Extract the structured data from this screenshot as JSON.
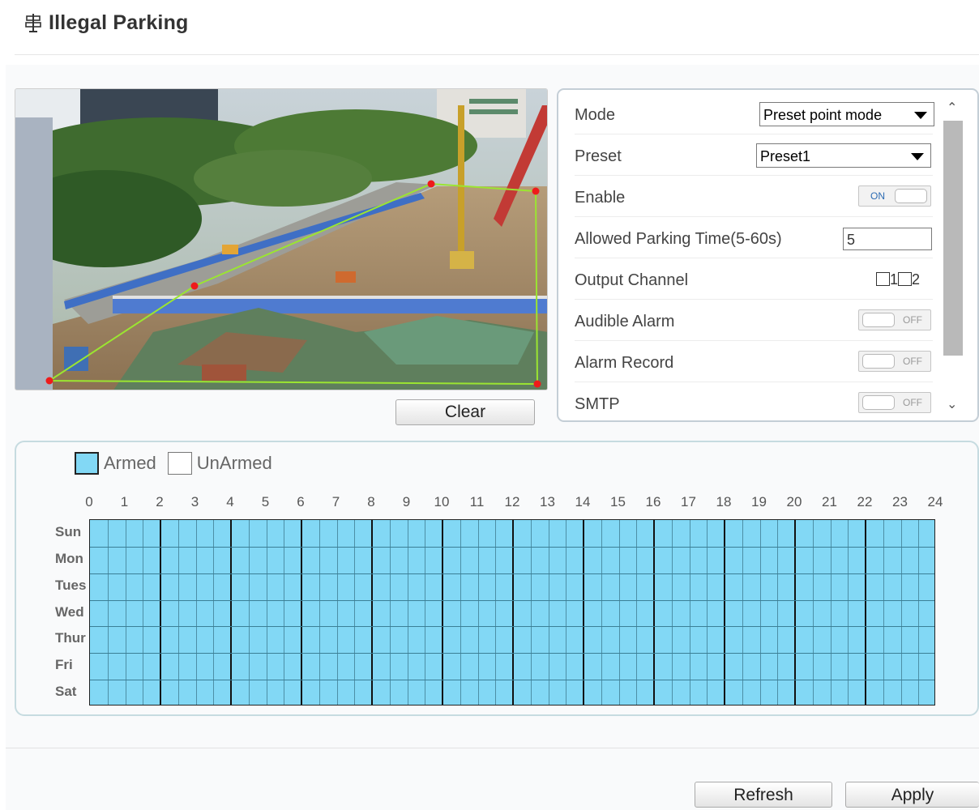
{
  "header": {
    "title": "Illegal Parking"
  },
  "video": {
    "polygon_points_label": "detection-area"
  },
  "clear_label": "Clear",
  "settings": {
    "mode": {
      "label": "Mode",
      "value": "Preset point mode"
    },
    "preset": {
      "label": "Preset",
      "value": "Preset1"
    },
    "enable": {
      "label": "Enable",
      "state": "ON"
    },
    "allowed_time": {
      "label": "Allowed Parking Time(5-60s)",
      "value": "5"
    },
    "output_channel": {
      "label": "Output Channel",
      "ch1": "1",
      "ch2": "2"
    },
    "audible_alarm": {
      "label": "Audible Alarm",
      "state": "OFF"
    },
    "alarm_record": {
      "label": "Alarm Record",
      "state": "OFF"
    },
    "smtp": {
      "label": "SMTP",
      "state": "OFF"
    }
  },
  "schedule": {
    "legend": {
      "armed": "Armed",
      "unarmed": "UnArmed"
    },
    "hours": [
      "0",
      "1",
      "2",
      "3",
      "4",
      "5",
      "6",
      "7",
      "8",
      "9",
      "10",
      "11",
      "12",
      "13",
      "14",
      "15",
      "16",
      "17",
      "18",
      "19",
      "20",
      "21",
      "22",
      "23",
      "24"
    ],
    "days": [
      "Sun",
      "Mon",
      "Tues",
      "Wed",
      "Thur",
      "Fri",
      "Sat"
    ],
    "armed_color": "#82d8f5"
  },
  "footer": {
    "refresh_label": "Refresh",
    "apply_label": "Apply"
  }
}
